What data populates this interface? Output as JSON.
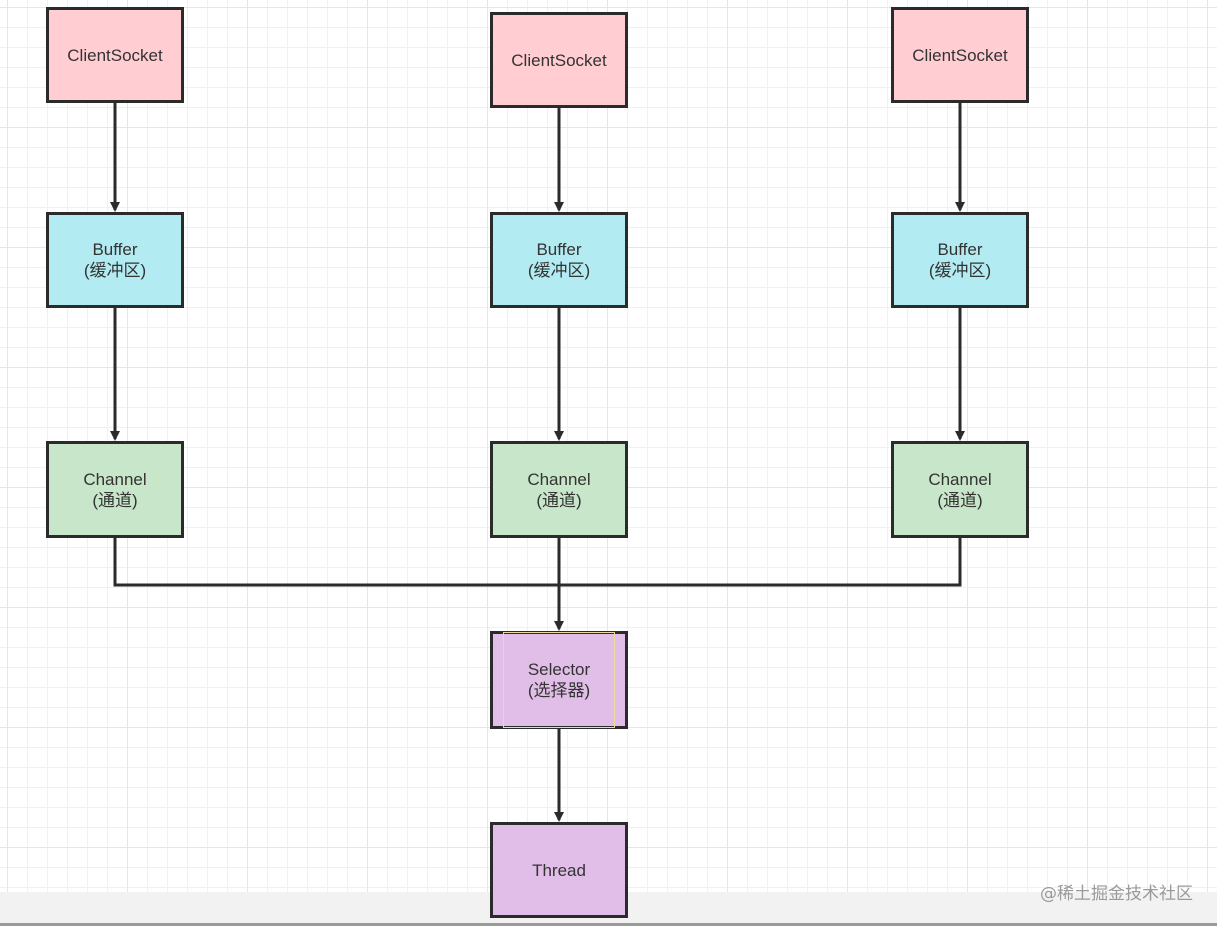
{
  "diagram": {
    "columns": [
      {
        "client": {
          "label": "ClientSocket"
        },
        "buffer": {
          "label": "Buffer",
          "sublabel": "(缓冲区)"
        },
        "channel": {
          "label": "Channel",
          "sublabel": "(通道)"
        }
      },
      {
        "client": {
          "label": "ClientSocket"
        },
        "buffer": {
          "label": "Buffer",
          "sublabel": "(缓冲区)"
        },
        "channel": {
          "label": "Channel",
          "sublabel": "(通道)"
        }
      },
      {
        "client": {
          "label": "ClientSocket"
        },
        "buffer": {
          "label": "Buffer",
          "sublabel": "(缓冲区)"
        },
        "channel": {
          "label": "Channel",
          "sublabel": "(通道)"
        }
      }
    ],
    "selector": {
      "label": "Selector",
      "sublabel": "(选择器)"
    },
    "thread": {
      "label": "Thread"
    },
    "colors": {
      "client": "#ffcdd2",
      "buffer": "#b2ebf2",
      "channel": "#c8e6c9",
      "selector": "#e1bee7",
      "thread": "#e1bee7",
      "stroke": "#2b2b2b"
    }
  },
  "watermark": "@稀土掘金技术社区"
}
